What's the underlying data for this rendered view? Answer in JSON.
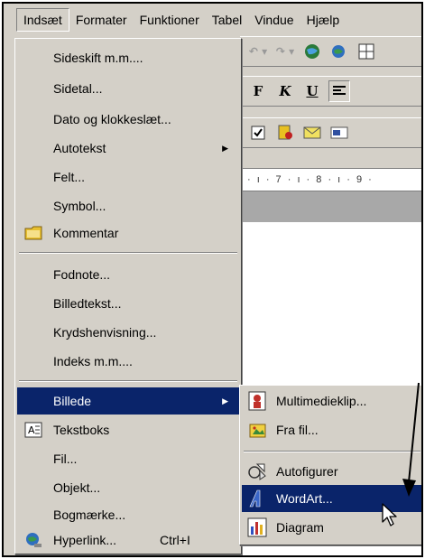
{
  "menubar": {
    "items": [
      "Indsæt",
      "Formater",
      "Funktioner",
      "Tabel",
      "Vindue",
      "Hjælp"
    ]
  },
  "background": {
    "format_buttons": [
      "F",
      "K",
      "U"
    ],
    "ruler_text": "· ı · 7 · ı · 8 · ı · 9 ·"
  },
  "insert_menu": {
    "items": [
      {
        "label": "Sideskift m.m....",
        "icon": "none"
      },
      {
        "label": "Sidetal...",
        "icon": "none"
      },
      {
        "label": "Dato og klokkeslæt...",
        "icon": "none"
      },
      {
        "label": "Autotekst",
        "icon": "none",
        "submenu": true
      },
      {
        "label": "Felt...",
        "icon": "none"
      },
      {
        "label": "Symbol...",
        "icon": "none"
      },
      {
        "label": "Kommentar",
        "icon": "comment-icon"
      },
      {
        "label": "Fodnote...",
        "icon": "none"
      },
      {
        "label": "Billedtekst...",
        "icon": "none"
      },
      {
        "label": "Krydshenvisning...",
        "icon": "none"
      },
      {
        "label": "Indeks m.m....",
        "icon": "none"
      },
      {
        "label": "Billede",
        "icon": "none",
        "submenu": true,
        "selected": true
      },
      {
        "label": "Tekstboks",
        "icon": "textbox-icon"
      },
      {
        "label": "Fil...",
        "icon": "none"
      },
      {
        "label": "Objekt...",
        "icon": "none"
      },
      {
        "label": "Bogmærke...",
        "icon": "none"
      },
      {
        "label": "Hyperlink...",
        "icon": "hyperlink-icon",
        "shortcut": "Ctrl+I"
      }
    ]
  },
  "picture_submenu": {
    "items": [
      {
        "label": "Multimedieklip...",
        "icon": "clipart-icon"
      },
      {
        "label": "Fra fil...",
        "icon": "from-file-icon"
      },
      {
        "label": "Autofigurer",
        "icon": "autoshapes-icon"
      },
      {
        "label": "WordArt...",
        "icon": "wordart-icon",
        "selected": true
      },
      {
        "label": "Diagram",
        "icon": "chart-icon"
      }
    ]
  },
  "colors": {
    "menu_face": "#d4d0c8",
    "highlight": "#0a246a",
    "highlight_text": "#ffffff"
  }
}
